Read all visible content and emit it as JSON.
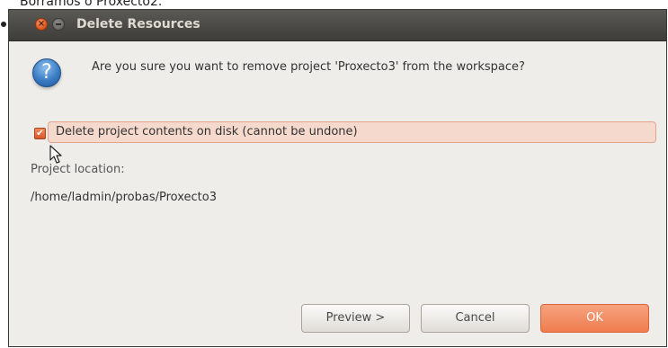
{
  "caption": "Borramos o Proxecto2.",
  "window": {
    "title": "Delete Resources"
  },
  "dialog": {
    "prompt": "Are you sure you want to remove project 'Proxecto3' from the workspace?",
    "delete_contents_label": "Delete project contents on disk (cannot be undone)",
    "delete_contents_checked": true,
    "location_label": "Project location:",
    "location_value": "/home/ladmin/probas/Proxecto3"
  },
  "buttons": {
    "preview": "Preview >",
    "cancel": "Cancel",
    "ok": "OK"
  },
  "colors": {
    "accent": "#ef7d4f",
    "titlebar": "#4a4945",
    "dialog_bg": "#efedea",
    "info_icon": "#3a7cc4"
  }
}
